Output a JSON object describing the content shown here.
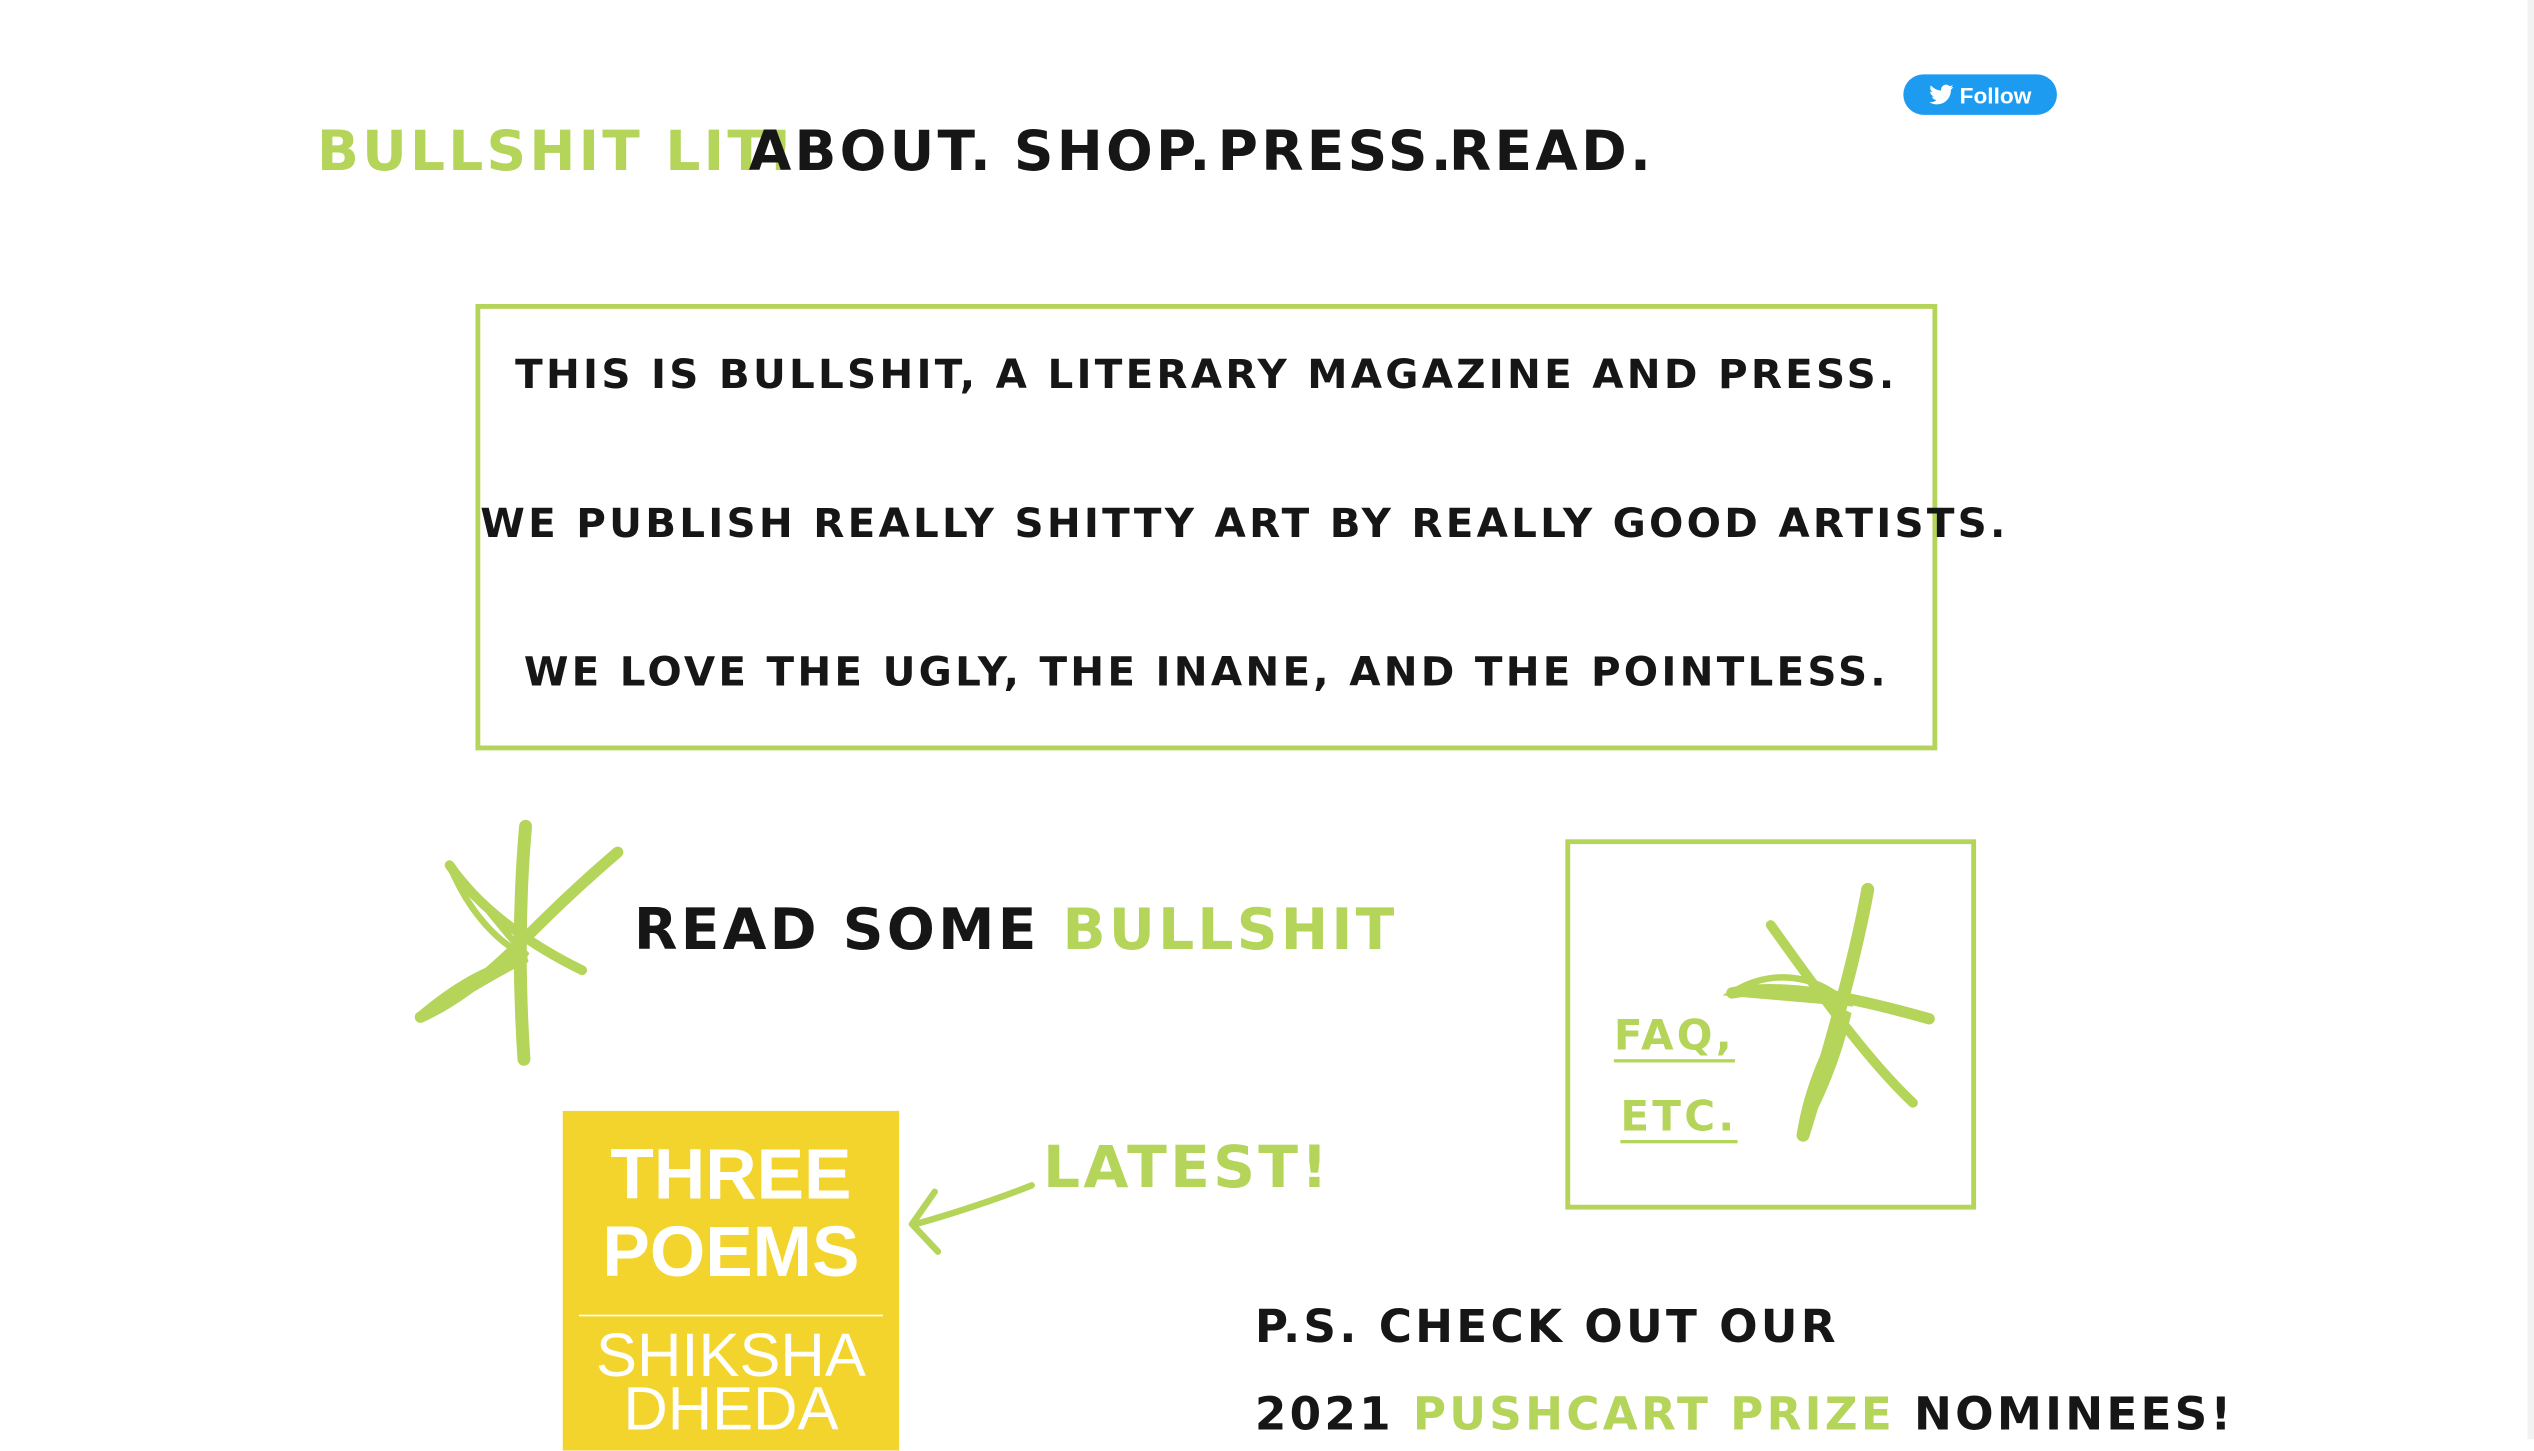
{
  "nav": {
    "brand": "BULLSHIT LIT!",
    "items": [
      "ABOUT.",
      "SHOP.",
      "PRESS.",
      "READ."
    ]
  },
  "twitter": {
    "follow_label": "Follow",
    "icon": "twitter-bird-icon"
  },
  "intro": {
    "lines": [
      "THIS IS BULLSHIT, A LITERARY MAGAZINE AND PRESS.",
      "WE PUBLISH REALLY SHITTY ART BY REALLY GOOD ARTISTS.",
      "WE LOVE THE UGLY, THE INANE, AND THE POINTLESS."
    ]
  },
  "read_cta": {
    "prefix": "READ SOME",
    "highlight": "BULLSHIT"
  },
  "faq": {
    "line1": "FAQ,",
    "line2": "ETC."
  },
  "latest": {
    "label": "LATEST!",
    "book_title_1": "THREE",
    "book_title_2": "POEMS",
    "book_author_1": "SHIKSHA",
    "book_author_2": "DHEDA"
  },
  "ps": {
    "line1": "P.S. CHECK OUT OUR",
    "line2_prefix": "2021",
    "line2_highlight": "PUSHCART PRIZE",
    "line2_suffix": "NOMINEES!"
  },
  "colors": {
    "accent": "#b4d45a",
    "text": "#161616",
    "cover": "#f2d42d",
    "twitter": "#1d9bf0"
  },
  "icons": [
    "asterisk-doodle-icon",
    "arrow-doodle-icon",
    "twitter-bird-icon"
  ]
}
